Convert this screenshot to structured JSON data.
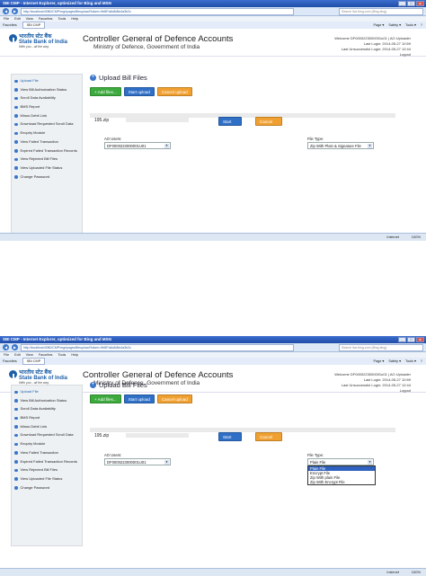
{
  "browser": {
    "title": "SBI CMP - Internet Explorer, optimized for Bing and MSN",
    "url": "http://localhost:9080/CMP/mgr/pages/fileupload?token=9b8f7a6c8d5e4a3b2c",
    "search_placeholder": "Search live.bing.com (Bing.bing)",
    "menu": [
      "File",
      "Edit",
      "View",
      "Favorites",
      "Tools",
      "Help"
    ],
    "favorites_label": "Favorites",
    "tab_label": "SBI CMP",
    "tools": [
      "Page ▾",
      "Safety ▾",
      "Tools ▾",
      "?"
    ],
    "status_zone": "Internet",
    "status_zoom": "100%",
    "winbtns": [
      "_",
      "□",
      "x"
    ],
    "back_icon": "◀",
    "forward_icon": "▶"
  },
  "header": {
    "logo_hindi": "भारतीय स्टेट बैंक",
    "logo_english": "State Bank of India",
    "logo_tagline": "With you - all the way",
    "org_title": "Controller General of Defence Accounts",
    "org_subtitle": "Ministry of Defence, Government of India"
  },
  "user_shot1": {
    "welcome": "Welcome DF0000223000001u01 | AO Uploader",
    "last_login": "Last Login: 2014-05-27 10:59",
    "last_unsuccessful": "Last Unsuccessful Login: 2014-05-27 12:44",
    "logout": "Logout"
  },
  "user_shot2": {
    "welcome": "Welcome DF0000223000001u01 | AO Uploader",
    "last_login": "Last Login: 2014-05-27 10:59",
    "last_unsuccessful": "Last Unsuccessful Login: 2014-05-27 12:44",
    "logout": "Logout"
  },
  "sidebar": {
    "items": [
      "Upload File",
      "View Bill Authorization Status",
      "Scroll Data Availability",
      "BMS Report",
      "Minus Debit Link",
      "Download Requested Scroll Data",
      "Enquiry Module",
      "View Failed Transaction",
      "Expired Failed Transaction Records",
      "View Rejected Bill Files",
      "View Uploaded File Status",
      "Change Password"
    ]
  },
  "main": {
    "title": "Upload Bill Files",
    "add_files": "+ Add files...",
    "start_upload": "Start upload",
    "cancel_upload": "Cancel upload",
    "file_name": "195.zip",
    "start": "Start",
    "cancel": "Cancel",
    "ao_label": "AO Users:",
    "ao_value": "DF0000223000001U01",
    "filetype_label": "File Type:",
    "filetype_value_shot1": "Zip With Plain & Signature File",
    "filetype_value_shot2": "Plain File",
    "filetype_options": [
      "Plain File",
      "Encrypt File",
      "Zip With plain File",
      "Zip With Encrypt File"
    ],
    "chevron": "▾"
  }
}
